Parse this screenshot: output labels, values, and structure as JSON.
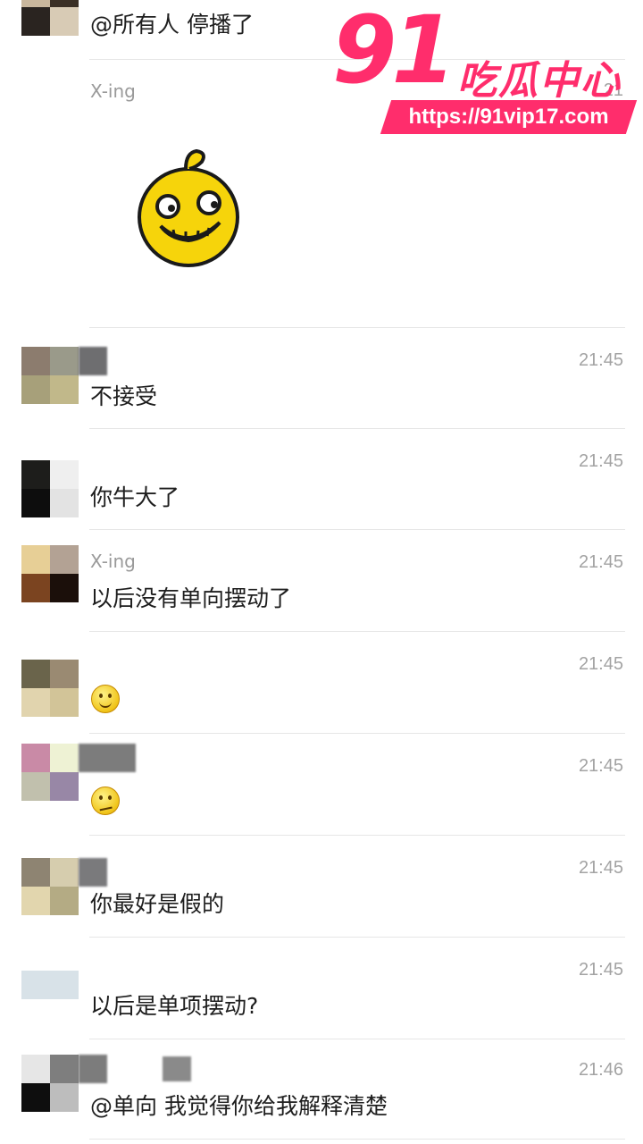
{
  "watermark": {
    "number": "91",
    "name": "吃瓜中心",
    "url": "https://91vip17.com"
  },
  "messages": [
    {
      "id": "m0",
      "sender": "",
      "text": "@所有人 停播了",
      "time": ""
    },
    {
      "id": "m1",
      "sender": "X-ing",
      "text": "",
      "time": "21",
      "sticker": "grinning-yellow-face-sticker"
    },
    {
      "id": "m2",
      "sender": "",
      "text": "不接受",
      "time": "21:45"
    },
    {
      "id": "m3",
      "sender": "",
      "text": "你牛大了",
      "time": "21:45"
    },
    {
      "id": "m4",
      "sender": "X-ing",
      "text": "以后没有单向摆动了",
      "time": "21:45"
    },
    {
      "id": "m5",
      "sender": "",
      "text": "",
      "time": "21:45",
      "emoji": "smile-emoji"
    },
    {
      "id": "m6",
      "sender": "",
      "text": "",
      "time": "21:45",
      "emoji": "puzzled-emoji"
    },
    {
      "id": "m7",
      "sender": "",
      "text": "你最好是假的",
      "time": "21:45"
    },
    {
      "id": "m8",
      "sender": "",
      "text": "以后是单项摆动?",
      "time": "21:45"
    },
    {
      "id": "m9",
      "sender": "",
      "text": "@单向 我觉得你给我解释清楚",
      "time": "21:46"
    }
  ]
}
